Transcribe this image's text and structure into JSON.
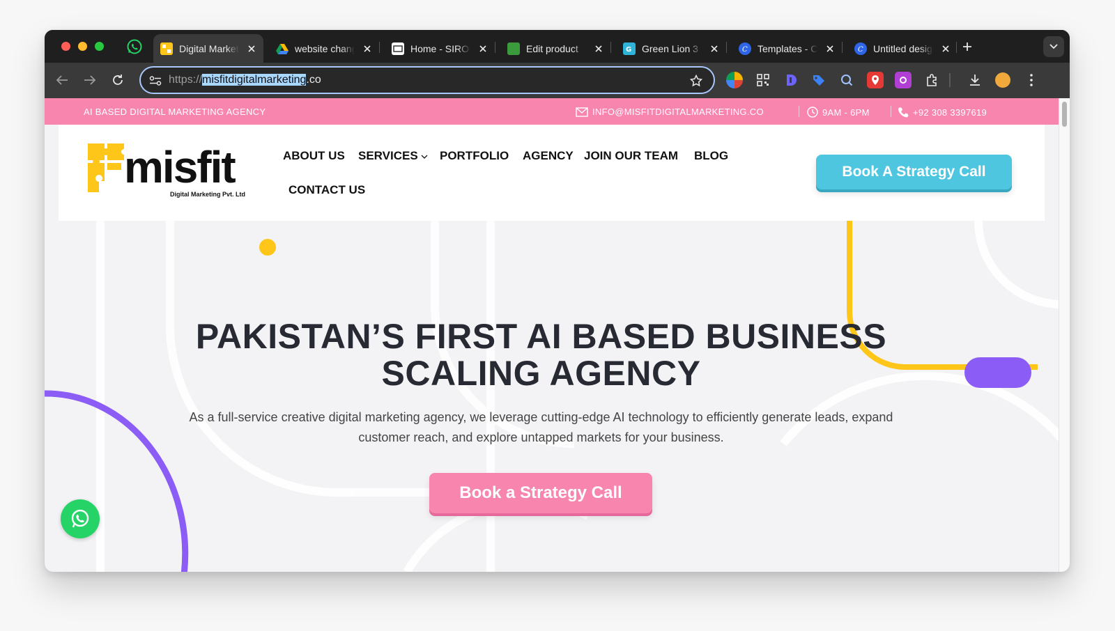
{
  "browser": {
    "tabs": [
      {
        "title": "Digital Marketing Agency",
        "active": true,
        "favicon": "misfit-favicon"
      },
      {
        "title": "website changes",
        "active": false,
        "favicon": "google-drive-icon"
      },
      {
        "title": "Home - SIROCCO",
        "active": false,
        "favicon": "siro-favicon"
      },
      {
        "title": "Edit product",
        "active": false,
        "favicon": "green-product-favicon"
      },
      {
        "title": "Green Lion 3",
        "active": false,
        "favicon": "green-lion-favicon"
      },
      {
        "title": "Templates - Canva",
        "active": false,
        "favicon": "canva-icon"
      },
      {
        "title": "Untitled design",
        "active": false,
        "favicon": "canva-icon"
      }
    ],
    "address_bar": {
      "scheme": "https://",
      "domain_selected": "misfitdigitalmarketing",
      "tld": ".co"
    },
    "colors": {
      "accent_focus": "#a8c7fa"
    }
  },
  "site": {
    "topbar": {
      "tagline": "AI BASED DIGITAL MARKETING AGENCY",
      "email": "INFO@MISFITDIGITALMARKETING.CO",
      "hours": "9AM - 6PM",
      "phone": "+92 308 3397619"
    },
    "logo": {
      "word": "misfit",
      "subtitle": "Digital Marketing Pvt. Ltd"
    },
    "nav": {
      "about": "ABOUT US",
      "services": "SERVICES",
      "portfolio": "PORTFOLIO",
      "agency": "AGENCY",
      "join": "JOIN OUR TEAM",
      "blog": "BLOG",
      "contact": "CONTACT US"
    },
    "header_cta": "Book A Strategy Call",
    "hero": {
      "title_line1": "PAKISTAN’S FIRST AI BASED BUSINESS",
      "title_line2": "SCALING AGENCY",
      "description": "As a full-service creative digital marketing agency, we leverage cutting-edge AI technology to efficiently generate leads, expand customer reach, and explore untapped markets for your business.",
      "cta": "Book a Strategy Call"
    },
    "colors": {
      "pink": "#f885ae",
      "cyan": "#4ec6e0",
      "yellow": "#ffc61a",
      "purple": "#8b5cf6",
      "whatsapp": "#25d366",
      "heading": "#272a33"
    }
  }
}
